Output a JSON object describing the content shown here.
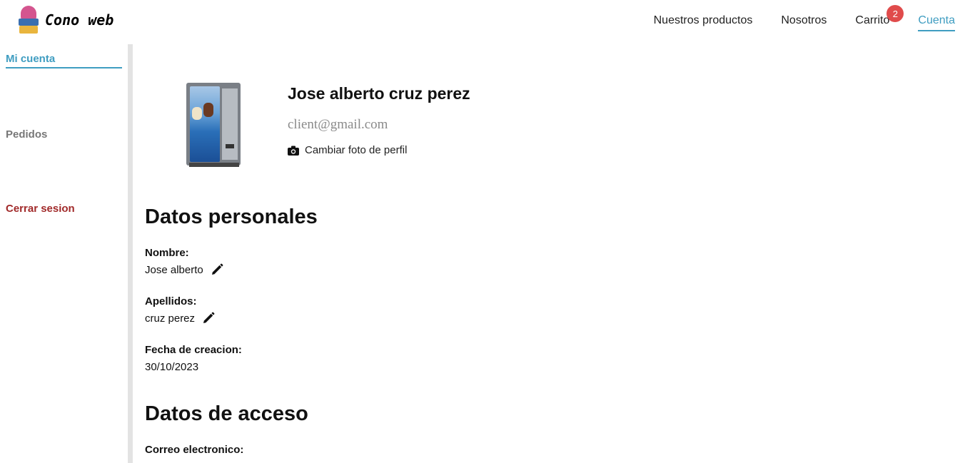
{
  "brand": {
    "name": "Cono web",
    "logo_icon": "ice-cream-cone-logo"
  },
  "nav": {
    "items": [
      {
        "label": "Nuestros productos"
      },
      {
        "label": "Nosotros"
      },
      {
        "label": "Carrito",
        "badge": "2"
      },
      {
        "label": "Cuenta",
        "active": true
      }
    ]
  },
  "sidebar": {
    "items": [
      {
        "label": "Mi cuenta",
        "state": "active"
      },
      {
        "label": "Pedidos",
        "state": "muted"
      },
      {
        "label": "Cerrar sesion",
        "state": "danger"
      }
    ]
  },
  "profile": {
    "photo_icon": "vending-machine-image",
    "name": "Jose alberto cruz perez",
    "email": "client@gmail.com",
    "change_photo_label": "Cambiar foto de perfil",
    "change_photo_icon": "camera-icon"
  },
  "personal": {
    "title": "Datos personales",
    "nombre_label": "Nombre:",
    "nombre_value": "Jose alberto",
    "apellidos_label": "Apellidos:",
    "apellidos_value": "cruz perez",
    "fecha_label": "Fecha de creacion:",
    "fecha_value": "30/10/2023",
    "edit_icon": "pencil-icon"
  },
  "access": {
    "title": "Datos de acceso",
    "correo_label": "Correo electronico:"
  },
  "colors": {
    "accent": "#3f9dc1",
    "danger": "#a12a2a",
    "badge": "#e04b4b",
    "muted": "#777777"
  }
}
